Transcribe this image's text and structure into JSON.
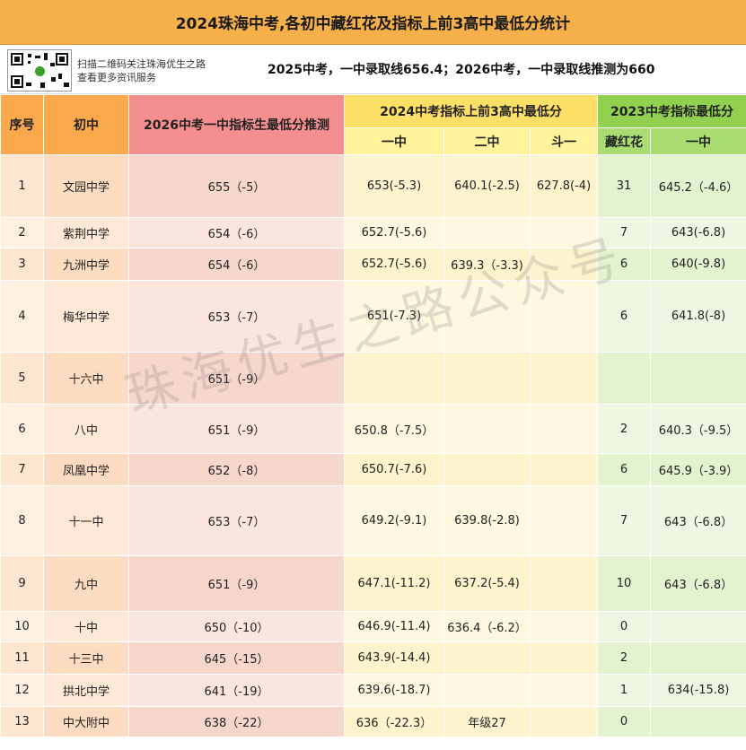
{
  "title": "2024珠海中考,各初中藏红花及指标上前3高中最低分统计",
  "info": {
    "scan_line1": "扫描二维码关注珠海优生之路",
    "scan_line2": "查看更多资讯服务",
    "headline": "2025中考，一中录取线656.4；2026中考，一中录取线推测为660"
  },
  "headers": {
    "index": "序号",
    "school": "初中",
    "prediction": "2026中考一中指标生最低分推测",
    "group2024": "2024中考指标上前3高中最低分",
    "group2023": "2023中考指标最低分",
    "yizhong": "一中",
    "erzhong": "二中",
    "douyi": "斗一",
    "zanghonghua": "藏红花",
    "yizhong2023": "一中"
  },
  "rows": [
    {
      "idx": "1",
      "school": "文园中学",
      "pred": "655（-5）",
      "y1": "653(-5.3)",
      "y2": "640.1(-2.5)",
      "y3": "627.8(-4)",
      "zhh": "31",
      "g1": "645.2（-4.6）"
    },
    {
      "idx": "2",
      "school": "紫荆中学",
      "pred": "654（-6）",
      "y1": "652.7(-5.6)",
      "y2": "",
      "y3": "",
      "zhh": "7",
      "g1": "643(-6.8)"
    },
    {
      "idx": "3",
      "school": "九洲中学",
      "pred": "654（-6）",
      "y1": "652.7(-5.6)",
      "y2": "639.3（-3.3)",
      "y3": "",
      "zhh": "6",
      "g1": "640(-9.8)"
    },
    {
      "idx": "4",
      "school": "梅华中学",
      "pred": "653（-7）",
      "y1": "651(-7.3)",
      "y2": "",
      "y3": "",
      "zhh": "6",
      "g1": "641.8(-8)"
    },
    {
      "idx": "5",
      "school": "十六中",
      "pred": "651（-9）",
      "y1": "",
      "y2": "",
      "y3": "",
      "zhh": "",
      "g1": ""
    },
    {
      "idx": "6",
      "school": "八中",
      "pred": "651（-9）",
      "y1": "650.8（-7.5）",
      "y2": "",
      "y3": "",
      "zhh": "2",
      "g1": "640.3（-9.5）"
    },
    {
      "idx": "7",
      "school": "凤凰中学",
      "pred": "652（-8）",
      "y1": "650.7(-7.6)",
      "y2": "",
      "y3": "",
      "zhh": "6",
      "g1": "645.9（-3.9）"
    },
    {
      "idx": "8",
      "school": "十一中",
      "pred": "653（-7）",
      "y1": "649.2(-9.1)",
      "y2": "639.8(-2.8)",
      "y3": "",
      "zhh": "7",
      "g1": "643（-6.8）"
    },
    {
      "idx": "9",
      "school": "九中",
      "pred": "651（-9）",
      "y1": "647.1(-11.2)",
      "y2": "637.2(-5.4)",
      "y3": "",
      "zhh": "10",
      "g1": "643（-6.8）"
    },
    {
      "idx": "10",
      "school": "十中",
      "pred": "650（-10）",
      "y1": "646.9(-11.4)",
      "y2": "636.4（-6.2）",
      "y3": "",
      "zhh": "0",
      "g1": ""
    },
    {
      "idx": "11",
      "school": "十三中",
      "pred": "645（-15）",
      "y1": "643.9(-14.4)",
      "y2": "",
      "y3": "",
      "zhh": "2",
      "g1": ""
    },
    {
      "idx": "12",
      "school": "拱北中学",
      "pred": "641（-19）",
      "y1": "639.6(-18.7)",
      "y2": "",
      "y3": "",
      "zhh": "1",
      "g1": "634(-15.8)"
    },
    {
      "idx": "13",
      "school": "中大附中",
      "pred": "638（-22）",
      "y1": "636（-22.3）",
      "y2": "年级27",
      "y3": "",
      "zhh": "0",
      "g1": ""
    }
  ],
  "watermark": "珠海优生之路公众号"
}
